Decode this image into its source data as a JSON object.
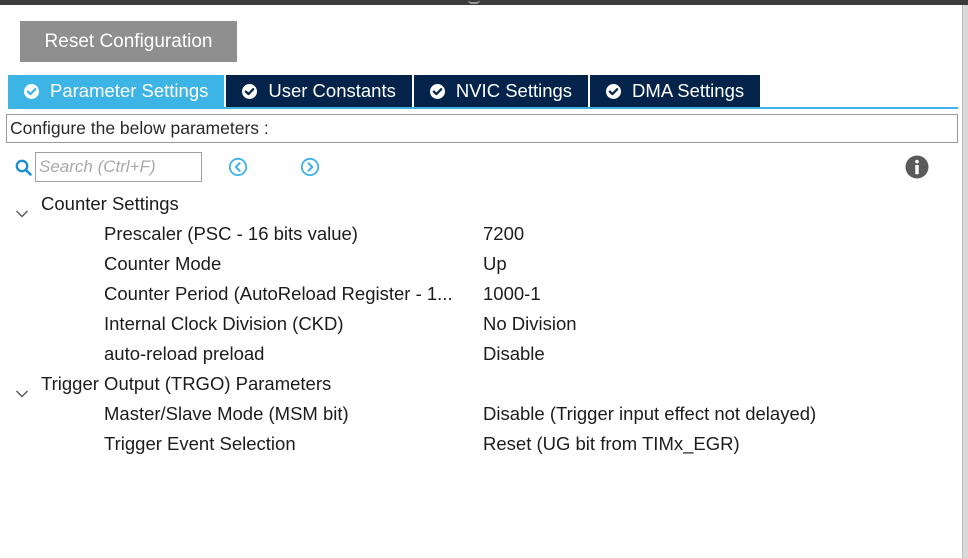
{
  "toolbar": {
    "reset_label": "Reset Configuration"
  },
  "tabs": [
    {
      "label": "Parameter Settings",
      "active": true
    },
    {
      "label": "User Constants",
      "active": false
    },
    {
      "label": "NVIC Settings",
      "active": false
    },
    {
      "label": "DMA Settings",
      "active": false
    }
  ],
  "config_box": {
    "text": "Configure the below parameters :"
  },
  "search": {
    "placeholder": "Search (Ctrl+F)",
    "value": ""
  },
  "icons": {
    "search": "search-icon",
    "prev": "circle-chevron-left-icon",
    "next": "circle-chevron-right-icon",
    "info": "info-icon",
    "tab_check": "check-circle-icon",
    "expand": "chevron-down-icon"
  },
  "colors": {
    "tab_active": "#3cb4e5",
    "tab_inactive": "#03234b",
    "reset_button": "#8f8f8f",
    "nav_icon": "#3cb4e5"
  },
  "groups": [
    {
      "title": "Counter Settings",
      "params": [
        {
          "name": "Prescaler (PSC - 16 bits value)",
          "value": "7200"
        },
        {
          "name": "Counter Mode",
          "value": "Up"
        },
        {
          "name": "Counter Period (AutoReload Register - 1...",
          "value": "1000-1"
        },
        {
          "name": "Internal Clock Division (CKD)",
          "value": "No Division"
        },
        {
          "name": "auto-reload preload",
          "value": "Disable"
        }
      ]
    },
    {
      "title": "Trigger Output (TRGO) Parameters",
      "params": [
        {
          "name": "Master/Slave Mode (MSM bit)",
          "value": "Disable (Trigger input effect not delayed)"
        },
        {
          "name": "Trigger Event Selection",
          "value": "Reset (UG bit from TIMx_EGR)"
        }
      ]
    }
  ]
}
